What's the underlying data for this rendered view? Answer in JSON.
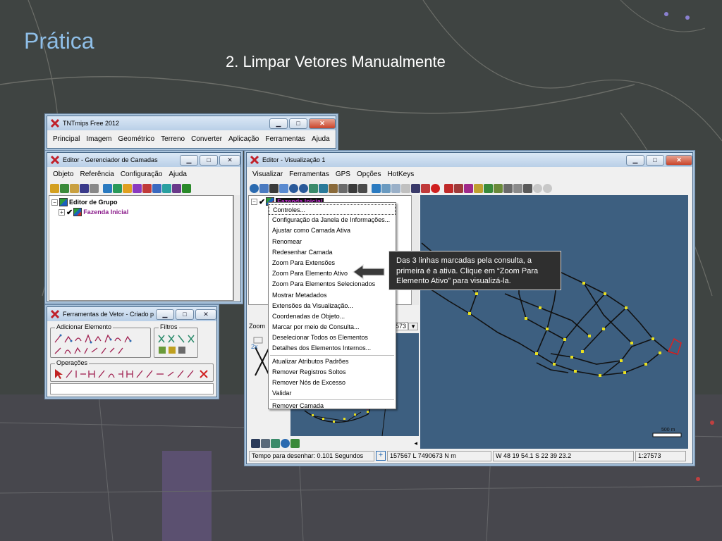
{
  "slide": {
    "title": "Prática",
    "subtitle": "2. Limpar Vetores Manualmente"
  },
  "colors": {
    "title": "#8fbfe8",
    "map_water": "#3d5f80",
    "map_line": "#1a1a1a",
    "callout_bg": "#2f2f2f"
  },
  "main_window": {
    "title": "TNTmips Free 2012",
    "menu": [
      "Principal",
      "Imagem",
      "Geométrico",
      "Terreno",
      "Converter",
      "Aplicação",
      "Ferramentas",
      "Ajuda"
    ]
  },
  "layer_manager": {
    "title": "Editor - Gerenciador de Camadas",
    "menu": [
      "Objeto",
      "Referência",
      "Configuração",
      "Ajuda"
    ],
    "tree": {
      "group": "Editor de Grupo",
      "layer": "Fazenda Inicial"
    }
  },
  "vector_tools": {
    "title": "Ferramentas de Vetor - Criado p...",
    "group_add": "Adicionar Elemento",
    "group_filters": "Filtros",
    "group_ops": "Operações"
  },
  "view_window": {
    "title": "Editor - Visualização 1",
    "menu": [
      "Visualizar",
      "Ferramentas",
      "GPS",
      "Opções",
      "HotKeys"
    ],
    "layer_selected": "Fazenda Inicial",
    "zoom_label": "Zoom",
    "zoom_value": "573",
    "side_zoom": "2x",
    "scale_bar": "500 m",
    "status": {
      "draw_time": "Tempo para desenhar: 0.101 Segundos",
      "coords": "157567 L  7490673 N m",
      "latlon": "W 48 19 54.1  S 22 39 23.2",
      "scale": "1:27573"
    }
  },
  "context_menu": {
    "items": [
      "Controles...",
      "Configuração da Janela de Informações...",
      "Ajustar como Camada Ativa",
      "Renomear",
      "Redesenhar Camada",
      "Zoom Para Extensões",
      "Zoom Para Elemento Ativo",
      "Zoom Para Elementos Selecionados",
      "Mostrar Metadados",
      "Extensões da Visualização...",
      "Coordenadas de Objeto...",
      "Marcar por meio de Consulta...",
      "Deselecionar Todos os Elementos",
      "Detalhes dos Elementos Internos...",
      "Atualizar Atributos Padrões",
      "Remover Registros Soltos",
      "Remover Nós de Excesso",
      "Validar",
      "Remover Camada"
    ]
  },
  "callout": {
    "text": "Das 3 linhas marcadas pela consulta, a primeira é a ativa. Clique em “Zoom Para Elemento Ativo” para visualizá-la."
  }
}
